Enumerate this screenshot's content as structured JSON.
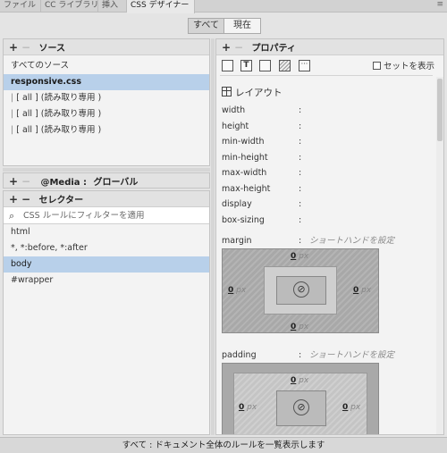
{
  "tabs": [
    "ファイル",
    "CC ライブラリ",
    "挿入",
    "CSS デザイナー"
  ],
  "tab_menu": "≡",
  "mode": {
    "all": "すべて",
    "current": "現在"
  },
  "sources": {
    "title": "ソース",
    "items": [
      "すべてのソース",
      "responsive.css",
      "[ all ] (読み取り専用 )",
      "[ all ] (読み取り専用 )",
      "[ all ] (読み取り専用 )"
    ]
  },
  "media": {
    "label": "@Media :",
    "value": "グローバル"
  },
  "selectors": {
    "title": "セレクター",
    "filter_placeholder": "CSS ルールにフィルターを適用",
    "items": [
      "html",
      "*, *:before, *:after",
      "body",
      "#wrapper"
    ]
  },
  "properties": {
    "title": "プロパティ",
    "show_set_label": "セットを表示",
    "section": "レイアウト",
    "layout_props": [
      "width",
      "height",
      "min-width",
      "min-height",
      "max-width",
      "max-height",
      "display",
      "box-sizing"
    ],
    "margin": {
      "name": "margin",
      "hint": "ショートハンドを設定"
    },
    "padding": {
      "name": "padding",
      "hint": "ショートハンドを設定"
    },
    "box_value": "0",
    "box_unit": "px"
  },
  "status": "すべて : ドキュメント全体のルールを一覧表示します"
}
